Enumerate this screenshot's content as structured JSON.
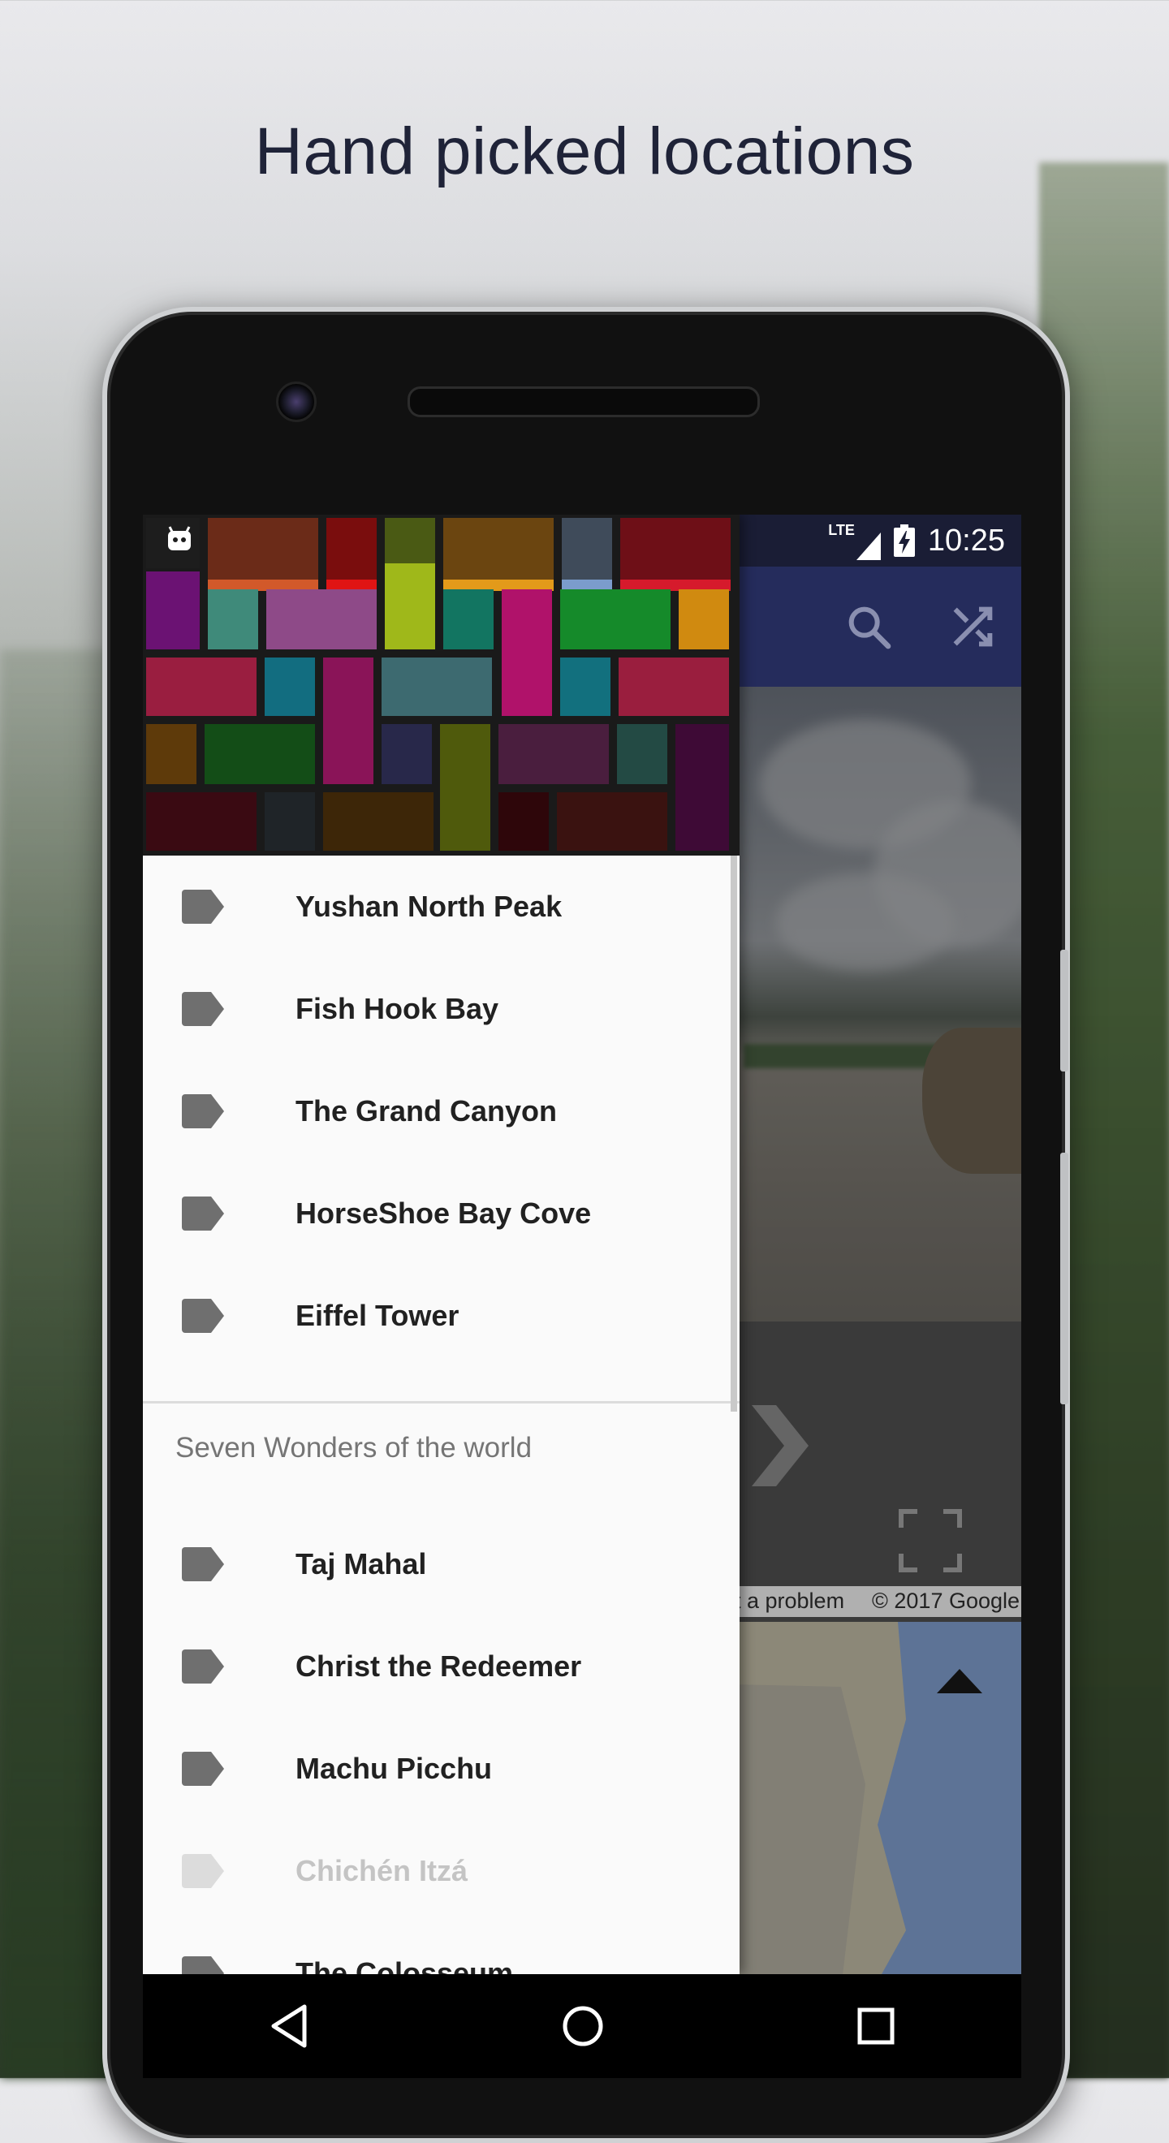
{
  "headline": "Hand picked locations",
  "status_bar": {
    "network": "LTE",
    "time": "10:25"
  },
  "app_bar": {
    "icons": [
      "search-icon",
      "shuffle-icon"
    ]
  },
  "street_view": {
    "attribution_report": "rt a problem",
    "attribution_copyright": "© 2017 Google"
  },
  "drawer": {
    "items": [
      {
        "label": "Yushan North Peak"
      },
      {
        "label": "Fish Hook Bay"
      },
      {
        "label": "The Grand Canyon"
      },
      {
        "label": "HorseShoe Bay Cove"
      },
      {
        "label": "Eiffel Tower"
      }
    ],
    "section_title": "Seven Wonders of the world",
    "section_items": [
      {
        "label": "Taj Mahal"
      },
      {
        "label": "Christ the Redeemer"
      },
      {
        "label": "Machu Picchu"
      },
      {
        "label": "Chichén Itzá",
        "disabled": true
      },
      {
        "label": "The Colosseum"
      }
    ]
  },
  "colors": {
    "app_bar": "#252c5c",
    "status_bar": "#1a1d35",
    "drawer_bg": "#fafafa",
    "tag_icon": "#6f6f6f",
    "tag_icon_disabled": "#dcdcdc"
  },
  "nav_bar": {
    "icons": [
      "back-icon",
      "home-icon",
      "recents-icon"
    ]
  }
}
